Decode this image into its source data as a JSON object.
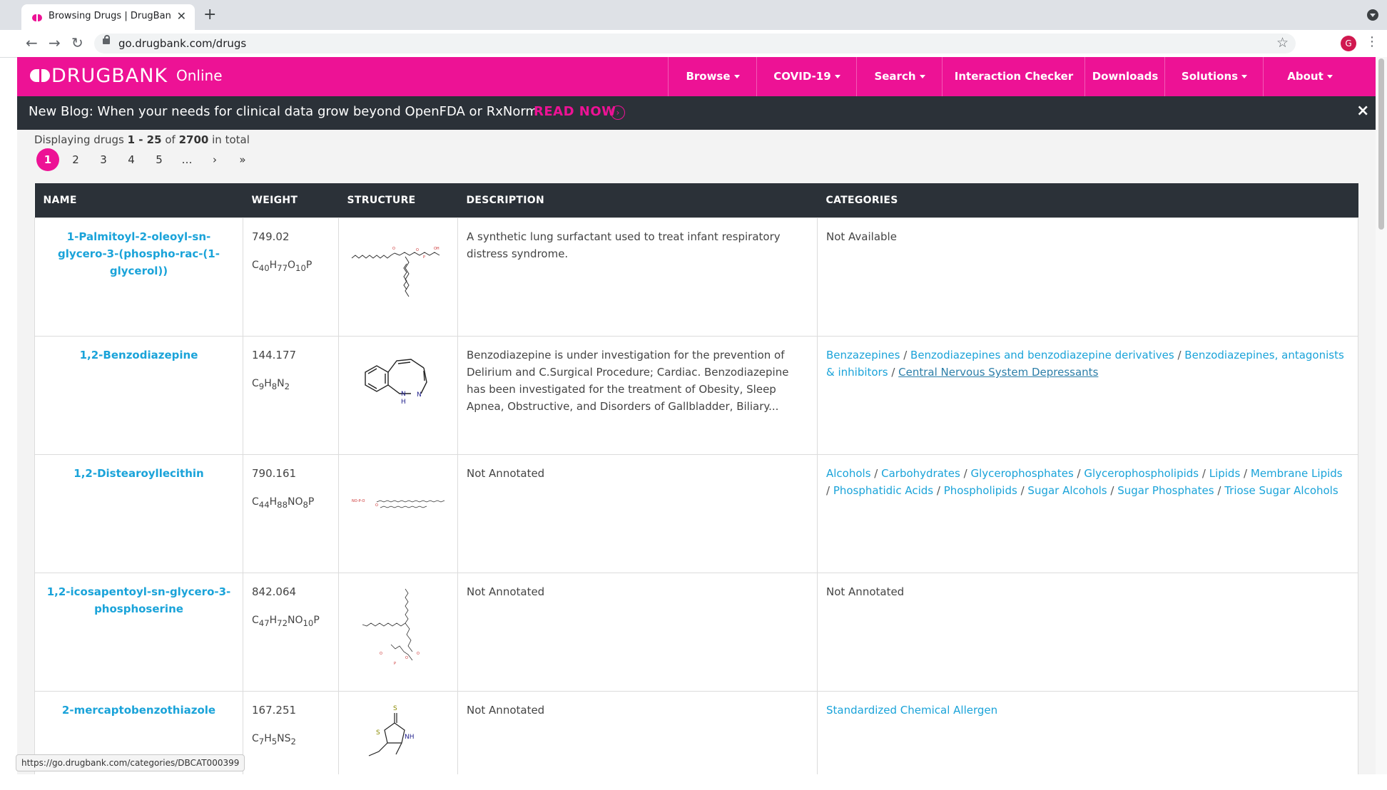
{
  "browser": {
    "tab_title": "Browsing Drugs | DrugBank On",
    "tab_close": "✕",
    "new_tab": "+",
    "url": "go.drugbank.com/drugs",
    "profile_initial": "G",
    "back_icon": "←",
    "forward_icon": "→",
    "reload_icon": "↻",
    "star_icon": "☆",
    "menu_icon": "⋮",
    "status_url": "https://go.drugbank.com/categories/DBCAT000399"
  },
  "header": {
    "logo_text": "DRUGBANK",
    "logo_suffix": "Online",
    "accent_color": "#ed1295",
    "menu": [
      {
        "label": "Browse",
        "dropdown": true
      },
      {
        "label": "COVID-19",
        "dropdown": true
      },
      {
        "label": "Search",
        "dropdown": true
      },
      {
        "label": "Interaction Checker",
        "dropdown": false
      },
      {
        "label": "Downloads",
        "dropdown": false
      },
      {
        "label": "Solutions",
        "dropdown": true
      },
      {
        "label": "About",
        "dropdown": true
      }
    ]
  },
  "banner": {
    "text": "New Blog: When your needs for clinical data grow beyond OpenFDA or RxNorm",
    "cta": "READ NOW",
    "close": "×"
  },
  "listing": {
    "prefix": "Displaying drugs",
    "range": "1 - 25",
    "of": "of",
    "total": "2700",
    "suffix": "in total"
  },
  "pagination": [
    "1",
    "2",
    "3",
    "4",
    "5",
    "…",
    "›",
    "»"
  ],
  "table": {
    "headers": [
      "NAME",
      "WEIGHT",
      "STRUCTURE",
      "DESCRIPTION",
      "CATEGORIES"
    ],
    "rows": [
      {
        "name": "1-Palmitoyl-2-oleoyl-sn-glycero-3-(phospho-rac-(1-glycerol))",
        "weight": "749.02",
        "formula": "C40H77O10P",
        "description": "A synthetic lung surfactant used to treat infant respiratory distress syndrome.",
        "categories": [
          "Not Available"
        ],
        "categories_linked": false
      },
      {
        "name": "1,2-Benzodiazepine",
        "weight": "144.177",
        "formula": "C9H8N2",
        "description": "Benzodiazepine is under investigation for the prevention of Delirium and C.Surgical Procedure; Cardiac. Benzodiazepine has been investigated for the treatment of Obesity, Sleep Apnea, Obstructive, and Disorders of Gallbladder, Biliary...",
        "categories": [
          "Benzazepines",
          "Benzodiazepines and benzodiazepine derivatives",
          "Benzodiazepines, antagonists & inhibitors",
          "Central Nervous System Depressants"
        ],
        "categories_linked": true
      },
      {
        "name": "1,2-Distearoyllecithin",
        "weight": "790.161",
        "formula": "C44H88NO8P",
        "description": "Not Annotated",
        "categories": [
          "Alcohols",
          "Carbohydrates",
          "Glycerophosphates",
          "Glycerophospholipids",
          "Lipids",
          "Membrane Lipids",
          "Phosphatidic Acids",
          "Phospholipids",
          "Sugar Alcohols",
          "Sugar Phosphates",
          "Triose Sugar Alcohols"
        ],
        "categories_linked": true
      },
      {
        "name": "1,2-icosapentoyl-sn-glycero-3-phosphoserine",
        "weight": "842.064",
        "formula": "C47H72NO10P",
        "description": "Not Annotated",
        "categories": [
          "Not Annotated"
        ],
        "categories_linked": false
      },
      {
        "name": "2-mercaptobenzothiazole",
        "weight": "167.251",
        "formula": "C7H5NS2",
        "description": "Not Annotated",
        "categories": [
          "Standardized Chemical Allergen"
        ],
        "categories_linked": true
      }
    ]
  }
}
